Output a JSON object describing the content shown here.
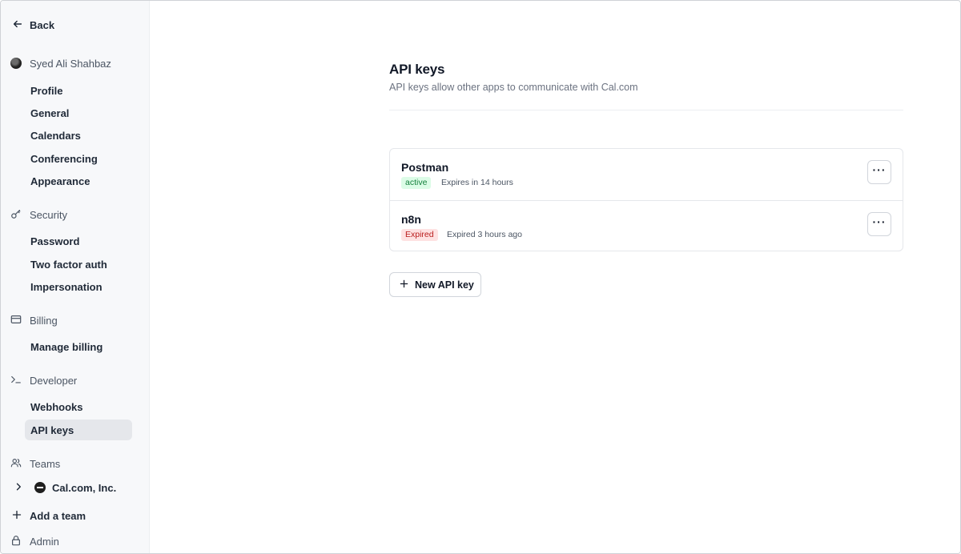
{
  "sidebar": {
    "back_label": "Back",
    "account": {
      "name": "Syed Ali Shahbaz",
      "items": [
        "Profile",
        "General",
        "Calendars",
        "Conferencing",
        "Appearance"
      ]
    },
    "security": {
      "label": "Security",
      "items": [
        "Password",
        "Two factor auth",
        "Impersonation"
      ]
    },
    "billing": {
      "label": "Billing",
      "items": [
        "Manage billing"
      ]
    },
    "developer": {
      "label": "Developer",
      "items": [
        "Webhooks",
        "API keys"
      ],
      "active_item": "API keys"
    },
    "teams": {
      "label": "Teams",
      "team_name": "Cal.com, Inc.",
      "add_team_label": "Add a team"
    },
    "admin_label": "Admin"
  },
  "main": {
    "title": "API keys",
    "subtitle": "API keys allow other apps to communicate with Cal.com",
    "keys": [
      {
        "name": "Postman",
        "status": "active",
        "expiry": "Expires in 14 hours"
      },
      {
        "name": "n8n",
        "status": "Expired",
        "expiry": "Expired 3 hours ago"
      }
    ],
    "new_key_label": "New API key",
    "more_label": "···"
  },
  "colors": {
    "sidebar_bg": "#f7f8fa",
    "active_badge_bg": "#dcfce7",
    "active_badge_text": "#15803d",
    "expired_badge_bg": "#fee2e2",
    "expired_badge_text": "#b91c1c"
  }
}
